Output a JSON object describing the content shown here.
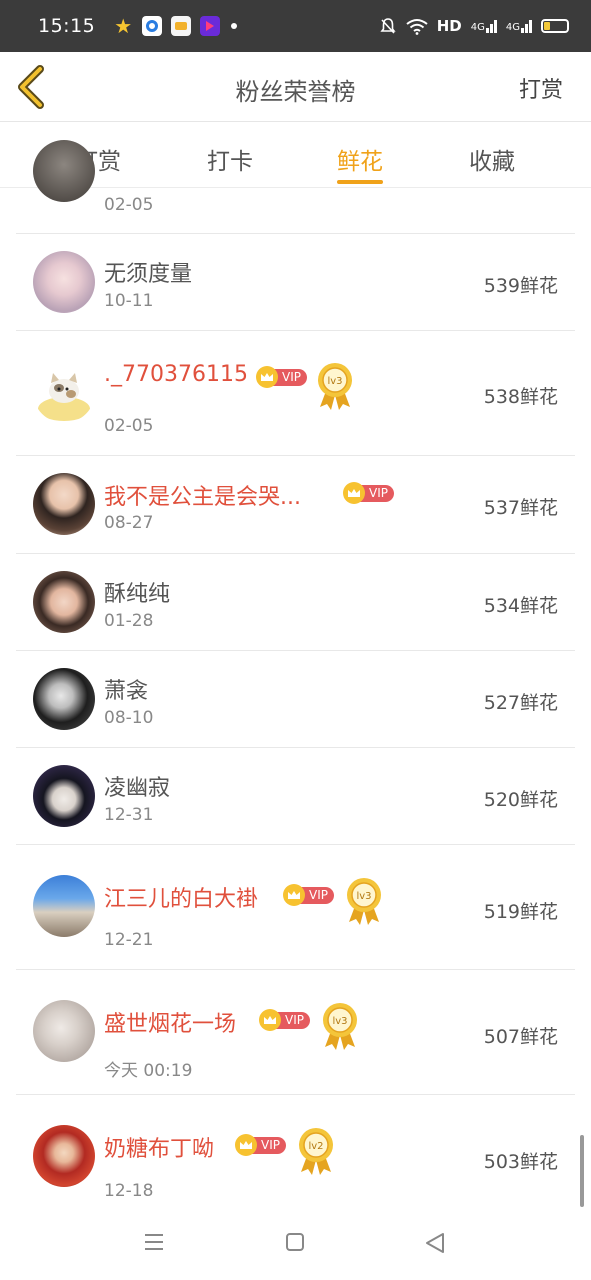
{
  "status_bar": {
    "time": "15:15",
    "network": "HD",
    "signal1": "4G",
    "signal2": "4G",
    "battery_level": 0.25
  },
  "header": {
    "title": "粉丝荣誉榜",
    "action_label": "打赏"
  },
  "tabs": [
    {
      "label": "打赏",
      "active": false
    },
    {
      "label": "打卡",
      "active": false
    },
    {
      "label": "鲜花",
      "active": true
    },
    {
      "label": "收藏",
      "active": false
    }
  ],
  "fans": [
    {
      "name": "",
      "date": "02-05",
      "amount": "",
      "vip": false,
      "level": ""
    },
    {
      "name": "无须度量",
      "date": "10-11",
      "amount": "539鲜花",
      "vip": false,
      "level": ""
    },
    {
      "name": "._770376115",
      "date": "02-05",
      "amount": "538鲜花",
      "vip": true,
      "level": "lv3"
    },
    {
      "name": "我不是公主是会哭...",
      "date": "08-27",
      "amount": "537鲜花",
      "vip": true,
      "level": ""
    },
    {
      "name": "酥纯纯",
      "date": "01-28",
      "amount": "534鲜花",
      "vip": false,
      "level": ""
    },
    {
      "name": "萧衾",
      "date": "08-10",
      "amount": "527鲜花",
      "vip": false,
      "level": ""
    },
    {
      "name": "凌幽寂",
      "date": "12-31",
      "amount": "520鲜花",
      "vip": false,
      "level": ""
    },
    {
      "name": "江三儿的白大褂",
      "date": "12-21",
      "amount": "519鲜花",
      "vip": true,
      "level": "lv3"
    },
    {
      "name": "盛世烟花一场",
      "date": "今天 00:19",
      "amount": "507鲜花",
      "vip": true,
      "level": "lv3"
    },
    {
      "name": "奶糖布丁呦",
      "date": "12-18",
      "amount": "503鲜花",
      "vip": true,
      "level": "lv2"
    }
  ],
  "vip_label": "VIP",
  "colors": {
    "accent": "#f0a21a",
    "vip_name": "#e0503c",
    "vip_tag": "#e55a5e",
    "crown": "#f7c230",
    "status_bar_bg": "#3b3b3b"
  },
  "icons": {
    "back": "chevron-left-icon",
    "home": "square-icon",
    "menu": "menu-icon",
    "nav_back": "triangle-back-icon",
    "level": "medal-icon",
    "vip": "crown-icon"
  }
}
